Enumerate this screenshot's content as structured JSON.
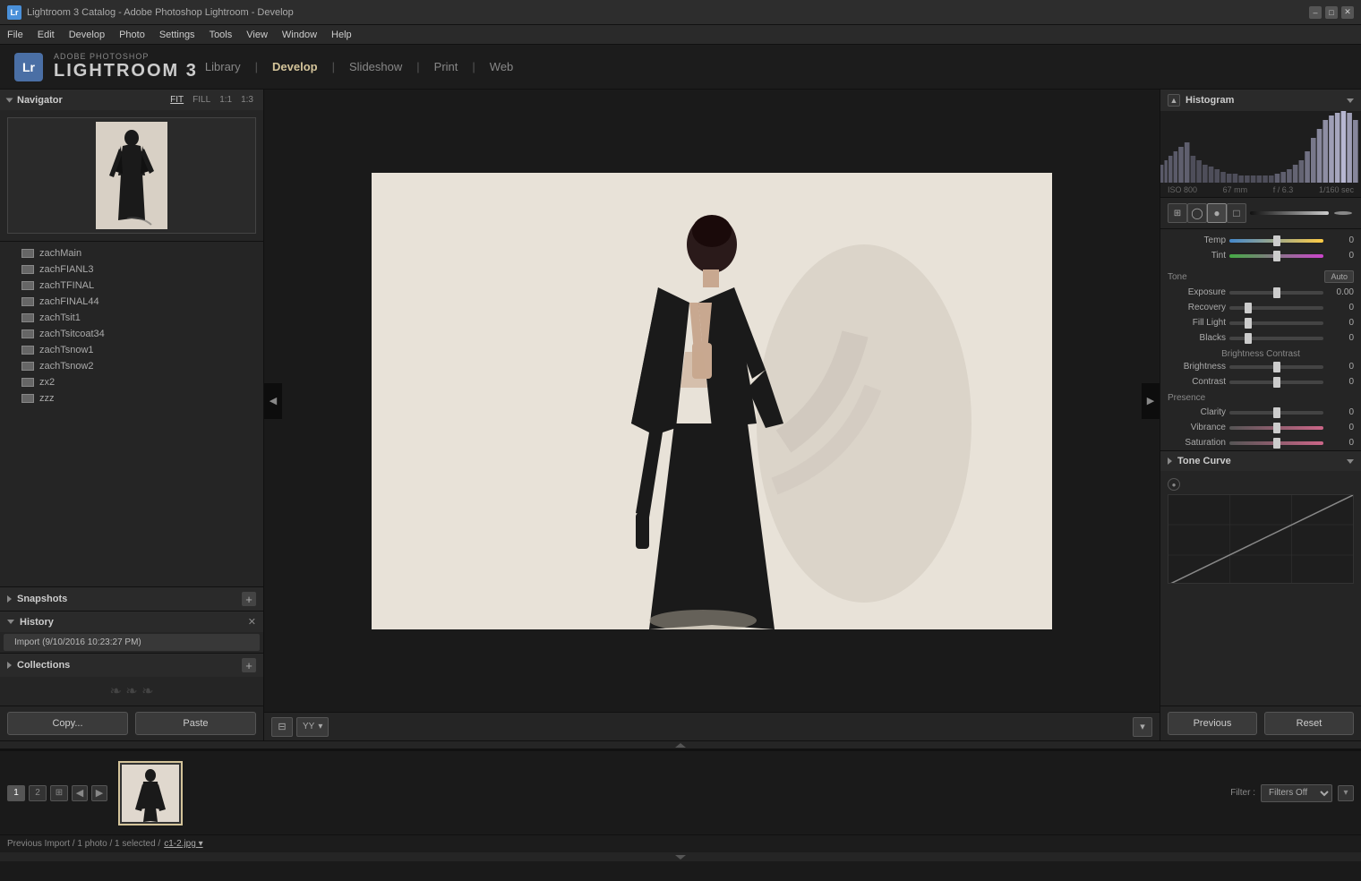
{
  "titleBar": {
    "icon": "Lr",
    "title": "Lightroom 3 Catalog - Adobe Photoshop Lightroom - Develop",
    "minimize": "–",
    "restore": "□",
    "close": "✕"
  },
  "menuBar": {
    "items": [
      "File",
      "Edit",
      "Develop",
      "Photo",
      "Settings",
      "Tools",
      "View",
      "Window",
      "Help"
    ]
  },
  "topNav": {
    "logoShort": "Lr",
    "logoTop": "ADOBE PHOTOSHOP",
    "logoMain": "LIGHTROOM 3",
    "navLinks": [
      "Library",
      "Develop",
      "Slideshow",
      "Print",
      "Web"
    ],
    "activeNav": "Develop"
  },
  "leftPanel": {
    "navigator": {
      "label": "Navigator",
      "options": [
        "FIT",
        "FILL",
        "1:1",
        "1:3"
      ]
    },
    "files": [
      "zachMain",
      "zachFIANL3",
      "zachTFINAL",
      "zachFINAL44",
      "zachTsit1",
      "zachTsitcoat34",
      "zachTsnow1",
      "zachTsnow2",
      "zx2",
      "zzz"
    ],
    "snapshots": {
      "label": "Snapshots",
      "addBtn": "+"
    },
    "history": {
      "label": "History",
      "closeBtn": "✕",
      "items": [
        "Import (9/10/2016 10:23:27 PM)"
      ]
    },
    "collections": {
      "label": "Collections",
      "addBtn": "+"
    },
    "copyBtn": "Copy...",
    "pasteBtn": "Paste"
  },
  "centerArea": {
    "toolbar": {
      "gridBtn": "⊟",
      "yyLabel": "YY ▾"
    }
  },
  "rightPanel": {
    "histogram": {
      "label": "Histogram",
      "iso": "ISO 800",
      "focal": "67 mm",
      "aperture": "f / 6.3",
      "shutter": "1/160 sec"
    },
    "tools": {
      "icons": [
        "⊞",
        "◯",
        "●",
        "□",
        "——"
      ]
    },
    "basicPanel": {
      "tempLabel": "Temp",
      "tempValue": "0",
      "tintLabel": "Tint",
      "tintValue": "0",
      "toneLabel": "Tone",
      "autoBtn": "Auto",
      "exposureLabel": "Exposure",
      "exposureValue": "0.00",
      "recoveryLabel": "Recovery",
      "recoveryValue": "0",
      "fillLightLabel": "Fill Light",
      "fillLightValue": "0",
      "blacksLabel": "Blacks",
      "blacksValue": "0",
      "brightnessLabel": "Brightness",
      "brightnessValue": "0",
      "contrastLabel": "Contrast",
      "contrastValue": "0",
      "presenceLabel": "Presence",
      "clarityLabel": "Clarity",
      "clarityValue": "0",
      "vibranceLabel": "Vibrance",
      "vibranceValue": "0",
      "saturationLabel": "Saturation",
      "saturationValue": "0"
    },
    "toneCurve": {
      "label": "Tone Curve"
    },
    "previousBtn": "Previous",
    "resetBtn": "Reset"
  },
  "filmstrip": {
    "pageNum1": "1",
    "pageNum2": "2",
    "filterLabel": "Filter :",
    "filterValue": "Filters Off"
  },
  "statusBar": {
    "pathPart1": "Previous Import / 1 photo / 1 selected /",
    "pathLink": "c1-2.jpg",
    "pathSuffix": "▾"
  }
}
